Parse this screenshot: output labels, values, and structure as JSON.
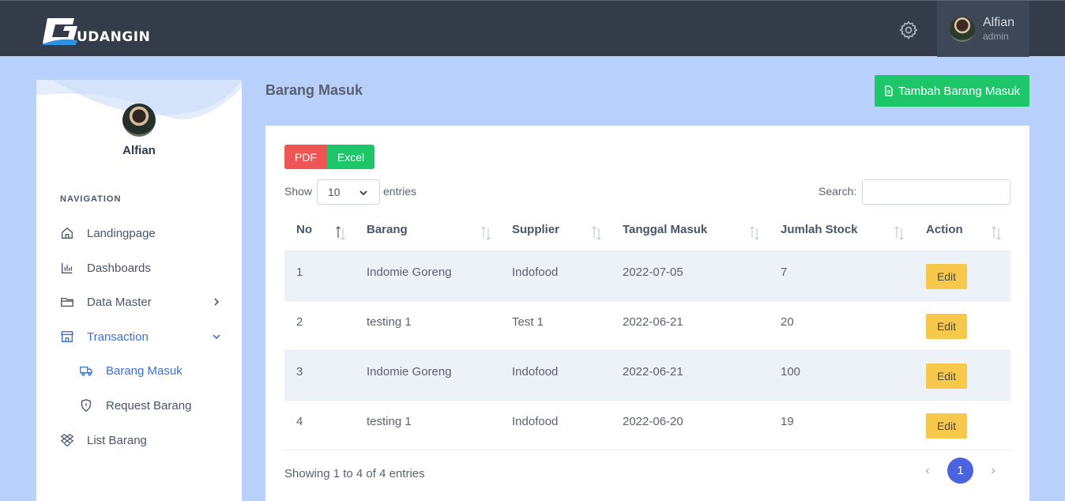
{
  "header": {
    "logo_text": "UDANGIN",
    "user_name": "Alfian",
    "user_role": "admin"
  },
  "sidebar": {
    "user_name": "Alfian",
    "heading": "NAVIGATION",
    "items": [
      {
        "label": "Landingpage",
        "icon": "home-icon"
      },
      {
        "label": "Dashboards",
        "icon": "bar-chart-icon"
      },
      {
        "label": "Data Master",
        "icon": "folder-icon"
      },
      {
        "label": "Transaction",
        "icon": "store-icon"
      },
      {
        "label": "List Barang",
        "icon": "dropbox-icon"
      }
    ],
    "sub_items": [
      {
        "label": "Barang Masuk",
        "icon": "truck-icon"
      },
      {
        "label": "Request Barang",
        "icon": "shield-icon"
      }
    ]
  },
  "main": {
    "title": "Barang Masuk",
    "add_button": "Tambah Barang Masuk",
    "pdf_button": "PDF",
    "excel_button": "Excel",
    "show_label": "Show",
    "entries_value": "10",
    "entries_label": "entries",
    "search_label": "Search:",
    "search_value": "",
    "columns": [
      "No",
      "Barang",
      "Supplier",
      "Tanggal Masuk",
      "Jumlah Stock",
      "Action"
    ],
    "rows": [
      {
        "no": "1",
        "barang": "Indomie Goreng",
        "supplier": "Indofood",
        "tanggal": "2022-07-05",
        "jumlah": "7",
        "action": "Edit"
      },
      {
        "no": "2",
        "barang": "testing 1",
        "supplier": "Test 1",
        "tanggal": "2022-06-21",
        "jumlah": "20",
        "action": "Edit"
      },
      {
        "no": "3",
        "barang": "Indomie Goreng",
        "supplier": "Indofood",
        "tanggal": "2022-06-21",
        "jumlah": "100",
        "action": "Edit"
      },
      {
        "no": "4",
        "barang": "testing 1",
        "supplier": "Indofood",
        "tanggal": "2022-06-20",
        "jumlah": "19",
        "action": "Edit"
      }
    ],
    "footer_info": "Showing 1 to 4 of 4 entries",
    "pagination": {
      "prev": "‹",
      "current": "1",
      "next": "›"
    }
  },
  "colors": {
    "header_bg": "#343c4a",
    "page_bg": "#b8d0fc",
    "accent_blue": "#3a6fd8",
    "success_green": "#1ec66a",
    "danger_red": "#f05454",
    "warning_yellow": "#f6c84c",
    "pagination_blue": "#4c63e0"
  }
}
